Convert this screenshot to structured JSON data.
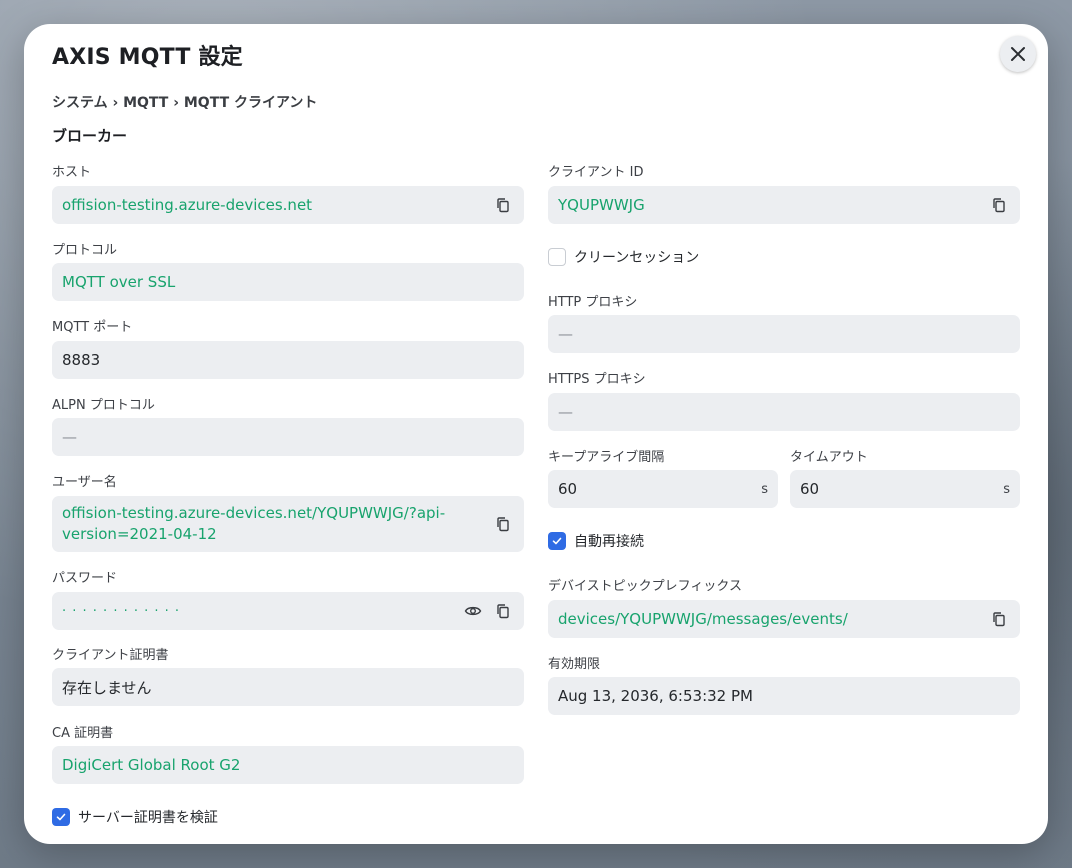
{
  "modal": {
    "title": "AXIS MQTT 設定",
    "breadcrumb": "システム › MQTT › MQTT クライアント",
    "section": "ブローカー"
  },
  "left": {
    "host": {
      "label": "ホスト",
      "value": "offision-testing.azure-devices.net"
    },
    "protocol": {
      "label": "プロトコル",
      "value": "MQTT over SSL"
    },
    "port": {
      "label": "MQTT ポート",
      "value": "8883"
    },
    "alpn": {
      "label": "ALPN プロトコル",
      "value": "—"
    },
    "username": {
      "label": "ユーザー名",
      "value": "offision-testing.azure-devices.net/YQUPWWJG/?api-version=2021-04-12"
    },
    "password": {
      "label": "パスワード",
      "value": "· · · · · · · · · · · ·"
    },
    "client_cert": {
      "label": "クライアント証明書",
      "value": "存在しません"
    },
    "ca_cert": {
      "label": "CA 証明書",
      "value": "DigiCert Global Root G2"
    },
    "verify_cert": {
      "label": "サーバー証明書を検証",
      "checked": true
    }
  },
  "right": {
    "client_id": {
      "label": "クライアント ID",
      "value": "YQUPWWJG"
    },
    "clean_session": {
      "label": "クリーンセッション",
      "checked": false
    },
    "http_proxy": {
      "label": "HTTP プロキシ",
      "value": "—"
    },
    "https_proxy": {
      "label": "HTTPS プロキシ",
      "value": "—"
    },
    "keepalive": {
      "label": "キープアライブ間隔",
      "value": "60",
      "unit": "s"
    },
    "timeout": {
      "label": "タイムアウト",
      "value": "60",
      "unit": "s"
    },
    "auto_reconnect": {
      "label": "自動再接続",
      "checked": true
    },
    "topic_prefix": {
      "label": "デバイストピックプレフィックス",
      "value": "devices/YQUPWWJG/messages/events/"
    },
    "expiry": {
      "label": "有効期限",
      "value": "Aug 13, 2036, 6:53:32 PM"
    }
  },
  "colors": {
    "accent": "#2f6be4",
    "value_green": "#18a36d",
    "field_bg": "#eceef1"
  },
  "icons": {
    "copy": "copy-icon",
    "eye": "eye-icon",
    "close": "close-icon",
    "check": "check-icon"
  }
}
